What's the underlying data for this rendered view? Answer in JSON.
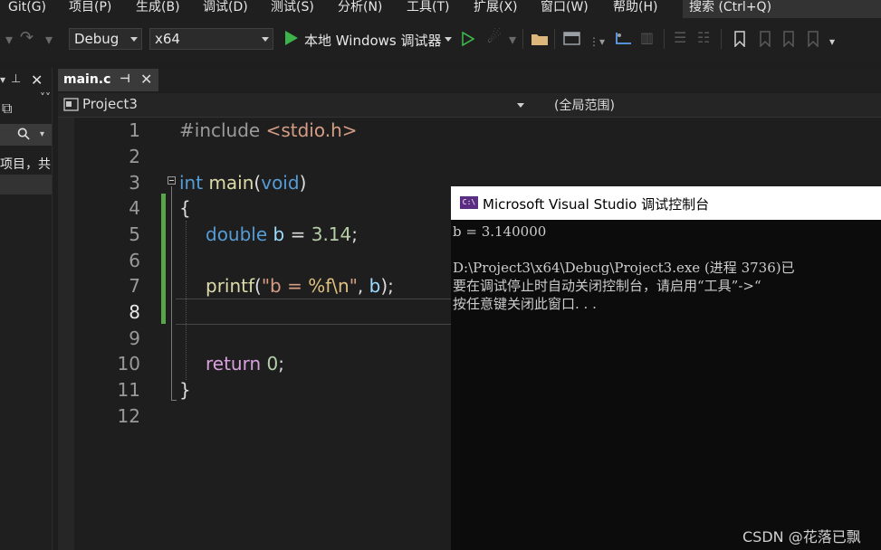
{
  "menu": {
    "items": [
      "Git(G)",
      "项目(P)",
      "生成(B)",
      "调试(D)",
      "测试(S)",
      "分析(N)",
      "工具(T)",
      "扩展(X)",
      "窗口(W)",
      "帮助(H)"
    ],
    "search": "搜索 (Ctrl+Q)"
  },
  "toolbar": {
    "config": "Debug",
    "platform": "x64",
    "run_label": "本地 Windows 调试器"
  },
  "left_panel": {
    "search_glyph": "⚲",
    "snippet": "项目，共"
  },
  "editor": {
    "tab_name": "main.c",
    "project": "Project3",
    "scope": "(全局范围)",
    "line_numbers": [
      "1",
      "2",
      "3",
      "4",
      "5",
      "6",
      "7",
      "8",
      "9",
      "10",
      "11",
      "12"
    ],
    "code": {
      "include_kw": "#include",
      "include_file": "<stdio.h>",
      "int_kw": "int",
      "main_fn": "main",
      "void_kw": "void",
      "open_brace": "{",
      "double_kw": "double",
      "var_b": "b",
      "assign": " = ",
      "val": "3.14",
      "semi": ";",
      "printf_fn": "printf",
      "fmt_a": "\"b = ",
      "fmt_spec": "%f",
      "fmt_esc": "\\n",
      "fmt_end": "\"",
      "printf_rest": ", ",
      "printf_close": ");",
      "return_kw": "return",
      "zero": "0",
      "close_brace": "}"
    }
  },
  "console": {
    "icon_text": "C:\\",
    "title": "Microsoft Visual Studio 调试控制台",
    "lines": [
      "b = 3.140000",
      "",
      "D:\\Project3\\x64\\Debug\\Project3.exe (进程 3736)已",
      "要在调试停止时自动关闭控制台，请启用“工具”->“",
      "按任意键关闭此窗口. . ."
    ]
  },
  "watermark": "CSDN @花落已飘",
  "colors": {
    "keyword": "#569cd6",
    "function": "#dcdcaa",
    "string": "#d69d85",
    "number": "#b5cea8",
    "control": "#d8a0df",
    "change_bar": "#57a64a"
  }
}
